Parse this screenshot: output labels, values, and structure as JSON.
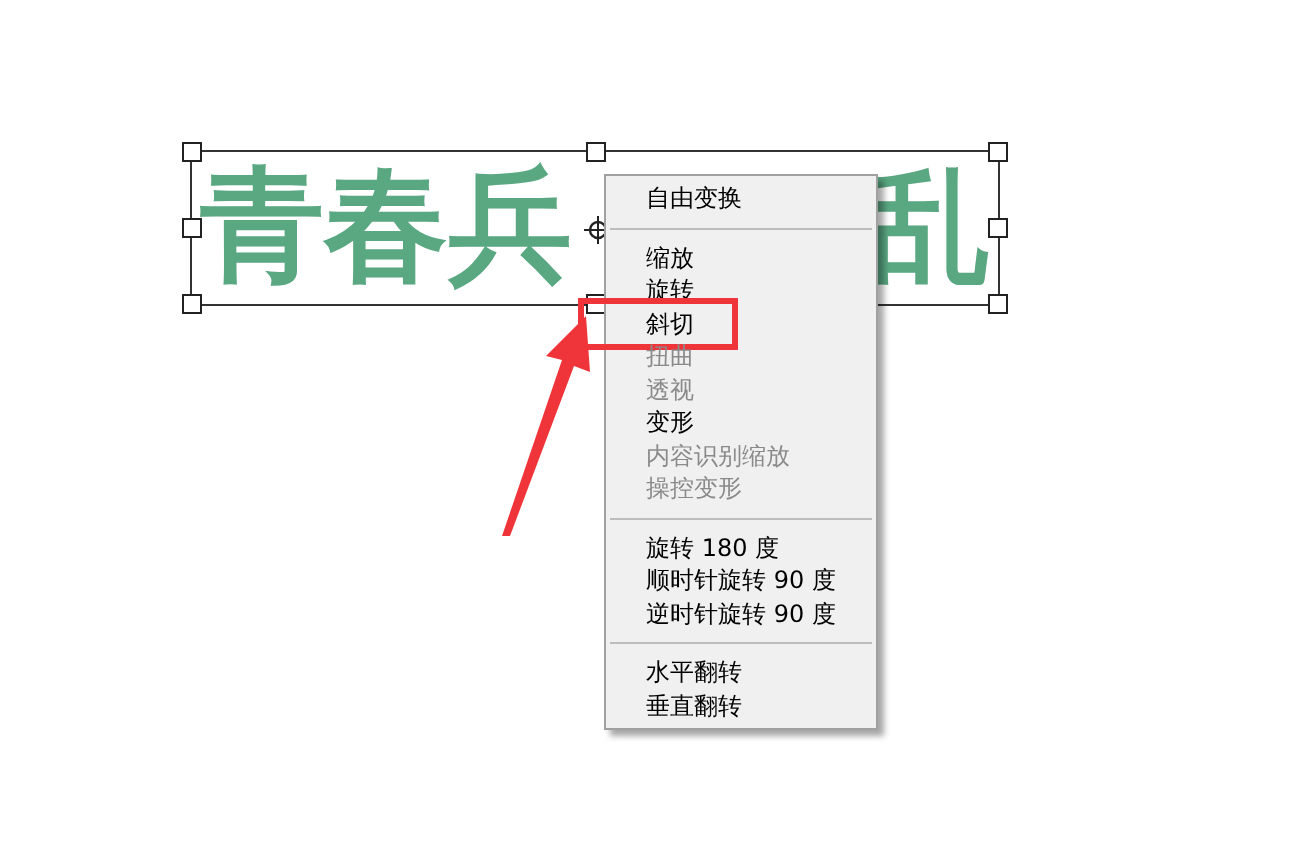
{
  "canvas": {
    "text_left": "青春兵",
    "text_right": "乱"
  },
  "context_menu": {
    "groups": [
      [
        {
          "label": "自由变换",
          "disabled": false,
          "highlighted": false
        }
      ],
      [
        {
          "label": "缩放",
          "disabled": false,
          "highlighted": false
        },
        {
          "label": "旋转",
          "disabled": false,
          "highlighted": false
        },
        {
          "label": "斜切",
          "disabled": false,
          "highlighted": true
        },
        {
          "label": "扭曲",
          "disabled": true,
          "highlighted": false
        },
        {
          "label": "透视",
          "disabled": true,
          "highlighted": false
        },
        {
          "label": "变形",
          "disabled": false,
          "highlighted": false
        },
        {
          "label": "内容识别缩放",
          "disabled": true,
          "highlighted": false
        },
        {
          "label": "操控变形",
          "disabled": true,
          "highlighted": false
        }
      ],
      [
        {
          "label": "旋转 180 度",
          "disabled": false,
          "highlighted": false
        },
        {
          "label": "顺时针旋转 90 度",
          "disabled": false,
          "highlighted": false
        },
        {
          "label": "逆时针旋转 90 度",
          "disabled": false,
          "highlighted": false
        }
      ],
      [
        {
          "label": "水平翻转",
          "disabled": false,
          "highlighted": false
        },
        {
          "label": "垂直翻转",
          "disabled": false,
          "highlighted": false
        }
      ]
    ]
  }
}
